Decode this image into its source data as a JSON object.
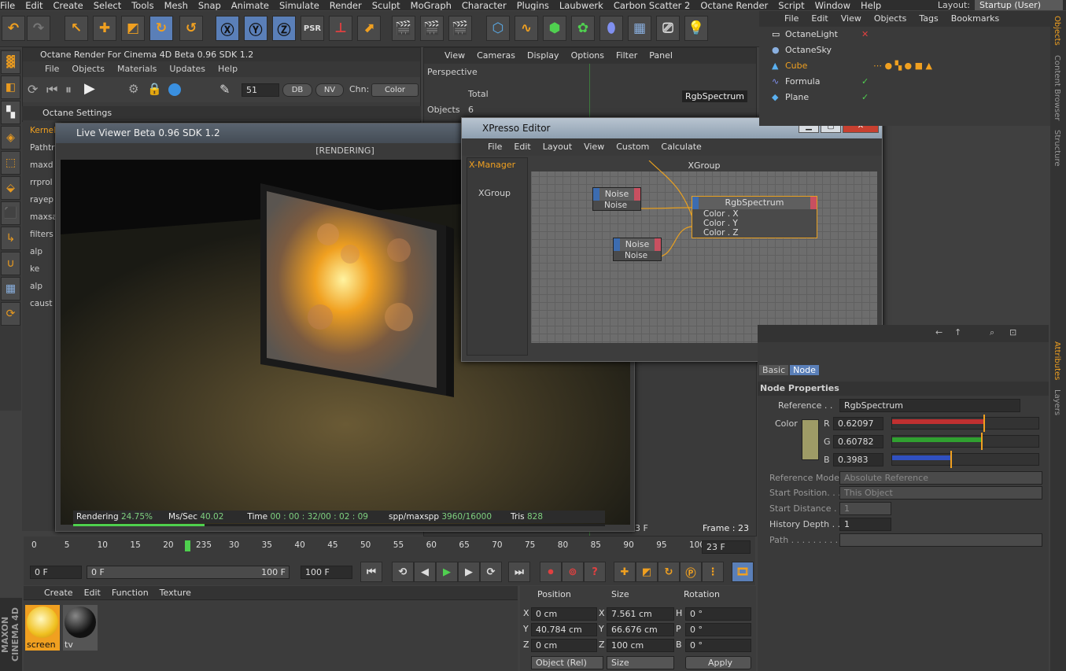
{
  "menu": [
    "File",
    "Edit",
    "Create",
    "Select",
    "Tools",
    "Mesh",
    "Snap",
    "Animate",
    "Simulate",
    "Render",
    "Sculpt",
    "MoGraph",
    "Character",
    "Plugins",
    "Laubwerk",
    "Carbon Scatter 2",
    "Octane Render",
    "Script",
    "Window",
    "Help"
  ],
  "layout": {
    "label": "Layout:",
    "value": "Startup (User)"
  },
  "octane": {
    "title": "Octane Render For Cinema 4D Beta 0.96   SDK 1.2",
    "menu": [
      "File",
      "Objects",
      "Materials",
      "Updates",
      "Help"
    ],
    "spp": "51",
    "db": "DB",
    "nv": "NV",
    "chn_label": "Chn:",
    "chn_value": "Color",
    "settings_title": "Octane Settings"
  },
  "kernel": {
    "tab": "Kernel",
    "items": [
      "Pathtr",
      "maxd",
      "rrprol",
      "rayep",
      "maxsa",
      "filters",
      "alp",
      "ke",
      "alp",
      "caust"
    ]
  },
  "viewport": {
    "menu": [
      "View",
      "Cameras",
      "Display",
      "Options",
      "Filter",
      "Panel"
    ],
    "label": "Perspective",
    "total_label": "Total",
    "objects_label": "Objects",
    "objects_value": "6",
    "tag": "RgbSpectrum",
    "frame": "Frame : 23",
    "frame_small": "3 F"
  },
  "liveviewer": {
    "title": "Live Viewer Beta 0.96   SDK 1.2",
    "state": "[RENDERING]",
    "status": {
      "rendering_label": "Rendering",
      "rendering_value": "24.75%",
      "mspersec_label": "Ms/Sec",
      "mspersec_value": "40.02",
      "time_label": "Time",
      "time_value": "00 : 00 : 32/00 : 02 : 09",
      "spp_label": "spp/maxspp",
      "spp_value": "3960/16000",
      "tris_label": "Tris",
      "tris_value": "828"
    },
    "progress": 0.2475
  },
  "xpresso": {
    "title": "XPresso Editor",
    "menu": [
      "File",
      "Edit",
      "Layout",
      "View",
      "Custom",
      "Calculate"
    ],
    "manager": "X-Manager",
    "group_item": "XGroup",
    "graph_title": "XGroup",
    "nodes": [
      {
        "title": "Noise",
        "port": "Noise"
      },
      {
        "title": "Noise",
        "port": "Noise"
      }
    ],
    "spectrum": {
      "title": "RgbSpectrum",
      "ports": [
        "Color . X",
        "Color . Y",
        "Color . Z"
      ]
    }
  },
  "objects": {
    "menu": [
      "File",
      "Edit",
      "View",
      "Objects",
      "Tags",
      "Bookmarks"
    ],
    "items": [
      "OctaneLight",
      "OctaneSky",
      "Cube",
      "Formula",
      "Plane"
    ]
  },
  "sidetabs": [
    "Objects",
    "Content Browser",
    "Structure",
    "Attributes",
    "Layers"
  ],
  "attributes": {
    "tabs": [
      "Basic",
      "Node"
    ],
    "section": "Node Properties",
    "reference_label": "Reference . .",
    "reference_value": "RgbSpectrum",
    "color_label": "Color",
    "r_label": "R",
    "r_value": "0.62097",
    "g_label": "G",
    "g_value": "0.60782",
    "b_label": "B",
    "b_value": "0.3983",
    "r": 0.62097,
    "g": 0.60782,
    "b": 0.3983,
    "scale": [
      "0.0",
      "0.1",
      "0.2",
      "0.3",
      "0.4",
      "0.5",
      "0.6",
      "0.7",
      "0.8",
      "0.9",
      "1.0"
    ],
    "refmode_label": "Reference Mode",
    "refmode_value": "Absolute Reference",
    "startpos_label": "Start Position. . .",
    "startpos_value": "This Object",
    "startdist_label": "Start Distance . .",
    "startdist_value": "1",
    "histdepth_label": "History Depth . .",
    "histdepth_value": "1",
    "path_label": "Path . . . . . . . . ."
  },
  "timeline": {
    "ticks": [
      "0",
      "5",
      "10",
      "15",
      "20",
      "235",
      "30",
      "35",
      "40",
      "45",
      "50",
      "55",
      "60",
      "65",
      "70",
      "75",
      "80",
      "85",
      "90",
      "95",
      "100"
    ],
    "current": "23 F"
  },
  "transport": {
    "start": "0 F",
    "range_start": "0 F",
    "range_end": "100 F",
    "end": "100 F"
  },
  "materials": {
    "menu": [
      "Create",
      "Edit",
      "Function",
      "Texture"
    ],
    "items": [
      "screen",
      "tv"
    ]
  },
  "coords": {
    "position_label": "Position",
    "size_label": "Size",
    "rotation_label": "Rotation",
    "rows": [
      {
        "axis": "X",
        "pos": "0 cm",
        "saxis": "X",
        "size": "7.561 cm",
        "raxis": "H",
        "rot": "0 °"
      },
      {
        "axis": "Y",
        "pos": "40.784 cm",
        "saxis": "Y",
        "size": "66.676 cm",
        "raxis": "P",
        "rot": "0 °"
      },
      {
        "axis": "Z",
        "pos": "0 cm",
        "saxis": "Z",
        "size": "100 cm",
        "raxis": "B",
        "rot": "0 °"
      }
    ],
    "mode": "Object (Rel)",
    "sizemode": "Size",
    "apply": "Apply"
  },
  "brand": "MAXON CINEMA 4D"
}
